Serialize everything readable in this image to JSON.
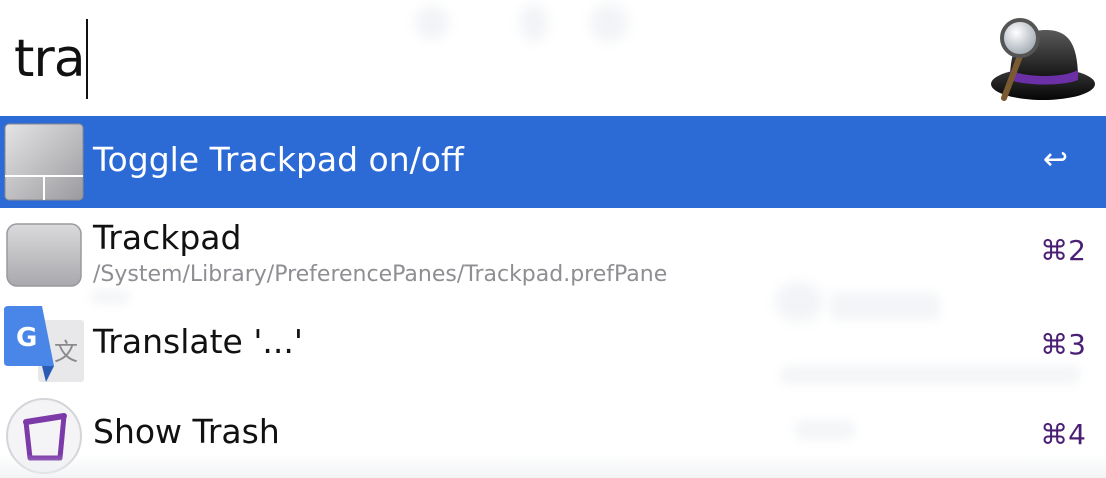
{
  "search": {
    "query": "tra"
  },
  "results": [
    {
      "title": "Toggle Trackpad on/off",
      "subtitle": "",
      "shortcut": "↩",
      "icon": "trackpad-icon",
      "selected": true
    },
    {
      "title": "Trackpad",
      "subtitle": "/System/Library/PreferencePanes/Trackpad.prefPane",
      "shortcut": "⌘2",
      "icon": "trackpad-icon",
      "selected": false
    },
    {
      "title": "Translate '...'",
      "subtitle": "",
      "shortcut": "⌘3",
      "icon": "google-translate-icon",
      "selected": false
    },
    {
      "title": "Show Trash",
      "subtitle": "",
      "shortcut": "⌘4",
      "icon": "trash-icon",
      "selected": false
    }
  ],
  "colors": {
    "selection": "#2c6ad6",
    "shortcut": "#4b1f73",
    "subtitle": "#8e8e93"
  }
}
